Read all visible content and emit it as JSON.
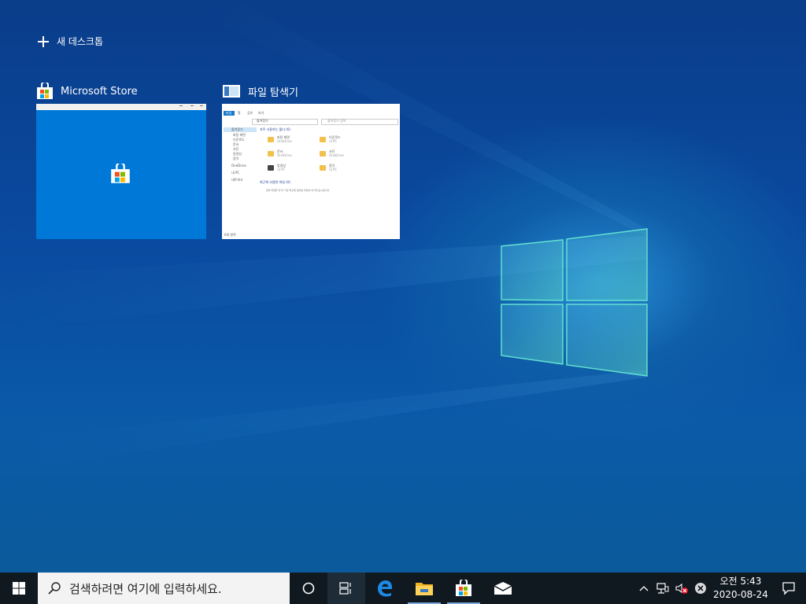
{
  "task_view": {
    "new_desktop_label": "새 데스크톱",
    "windows": [
      {
        "title": "Microsoft Store",
        "icon": "store-icon"
      },
      {
        "title": "파일 탐색기",
        "icon": "file-explorer-icon"
      }
    ]
  },
  "explorer_thumb": {
    "ribbon_tabs": [
      "파일",
      "홈",
      "공유",
      "보기"
    ],
    "address": "즐겨찾기",
    "search_placeholder": "즐겨찾기 검색",
    "nav_items": [
      "즐겨찾기",
      "바탕 화면",
      "다운로드",
      "문서",
      "사진",
      "동영상",
      "음악",
      "OneDrive",
      "내 PC",
      "네트워크"
    ],
    "frequent_header": "자주 사용하는 폴더 (6)",
    "folders": [
      {
        "name": "바탕 화면",
        "sub": "OneDrive"
      },
      {
        "name": "다운로드",
        "sub": "내 PC"
      },
      {
        "name": "문서",
        "sub": "OneDrive"
      },
      {
        "name": "사진",
        "sub": "OneDrive"
      },
      {
        "name": "동영상",
        "sub": "내 PC"
      },
      {
        "name": "음악",
        "sub": "내 PC"
      }
    ],
    "recent_header": "최근에 사용한 파일 (0)",
    "recent_empty": "일부 파일을 연 후 가장 최근에 열어본 파일이 여기에 표시됩니다.",
    "status": "6개 항목"
  },
  "taskbar": {
    "search_placeholder": "검색하려면 여기에 입력하세요.",
    "pinned": [
      "edge-icon",
      "file-explorer-icon",
      "store-icon",
      "mail-icon"
    ],
    "clock_time": "오전 5:43",
    "clock_date": "2020-08-24"
  },
  "colors": {
    "accent": "#0078d7",
    "taskbar": "#101820",
    "desktop": "#0a4aa0"
  }
}
